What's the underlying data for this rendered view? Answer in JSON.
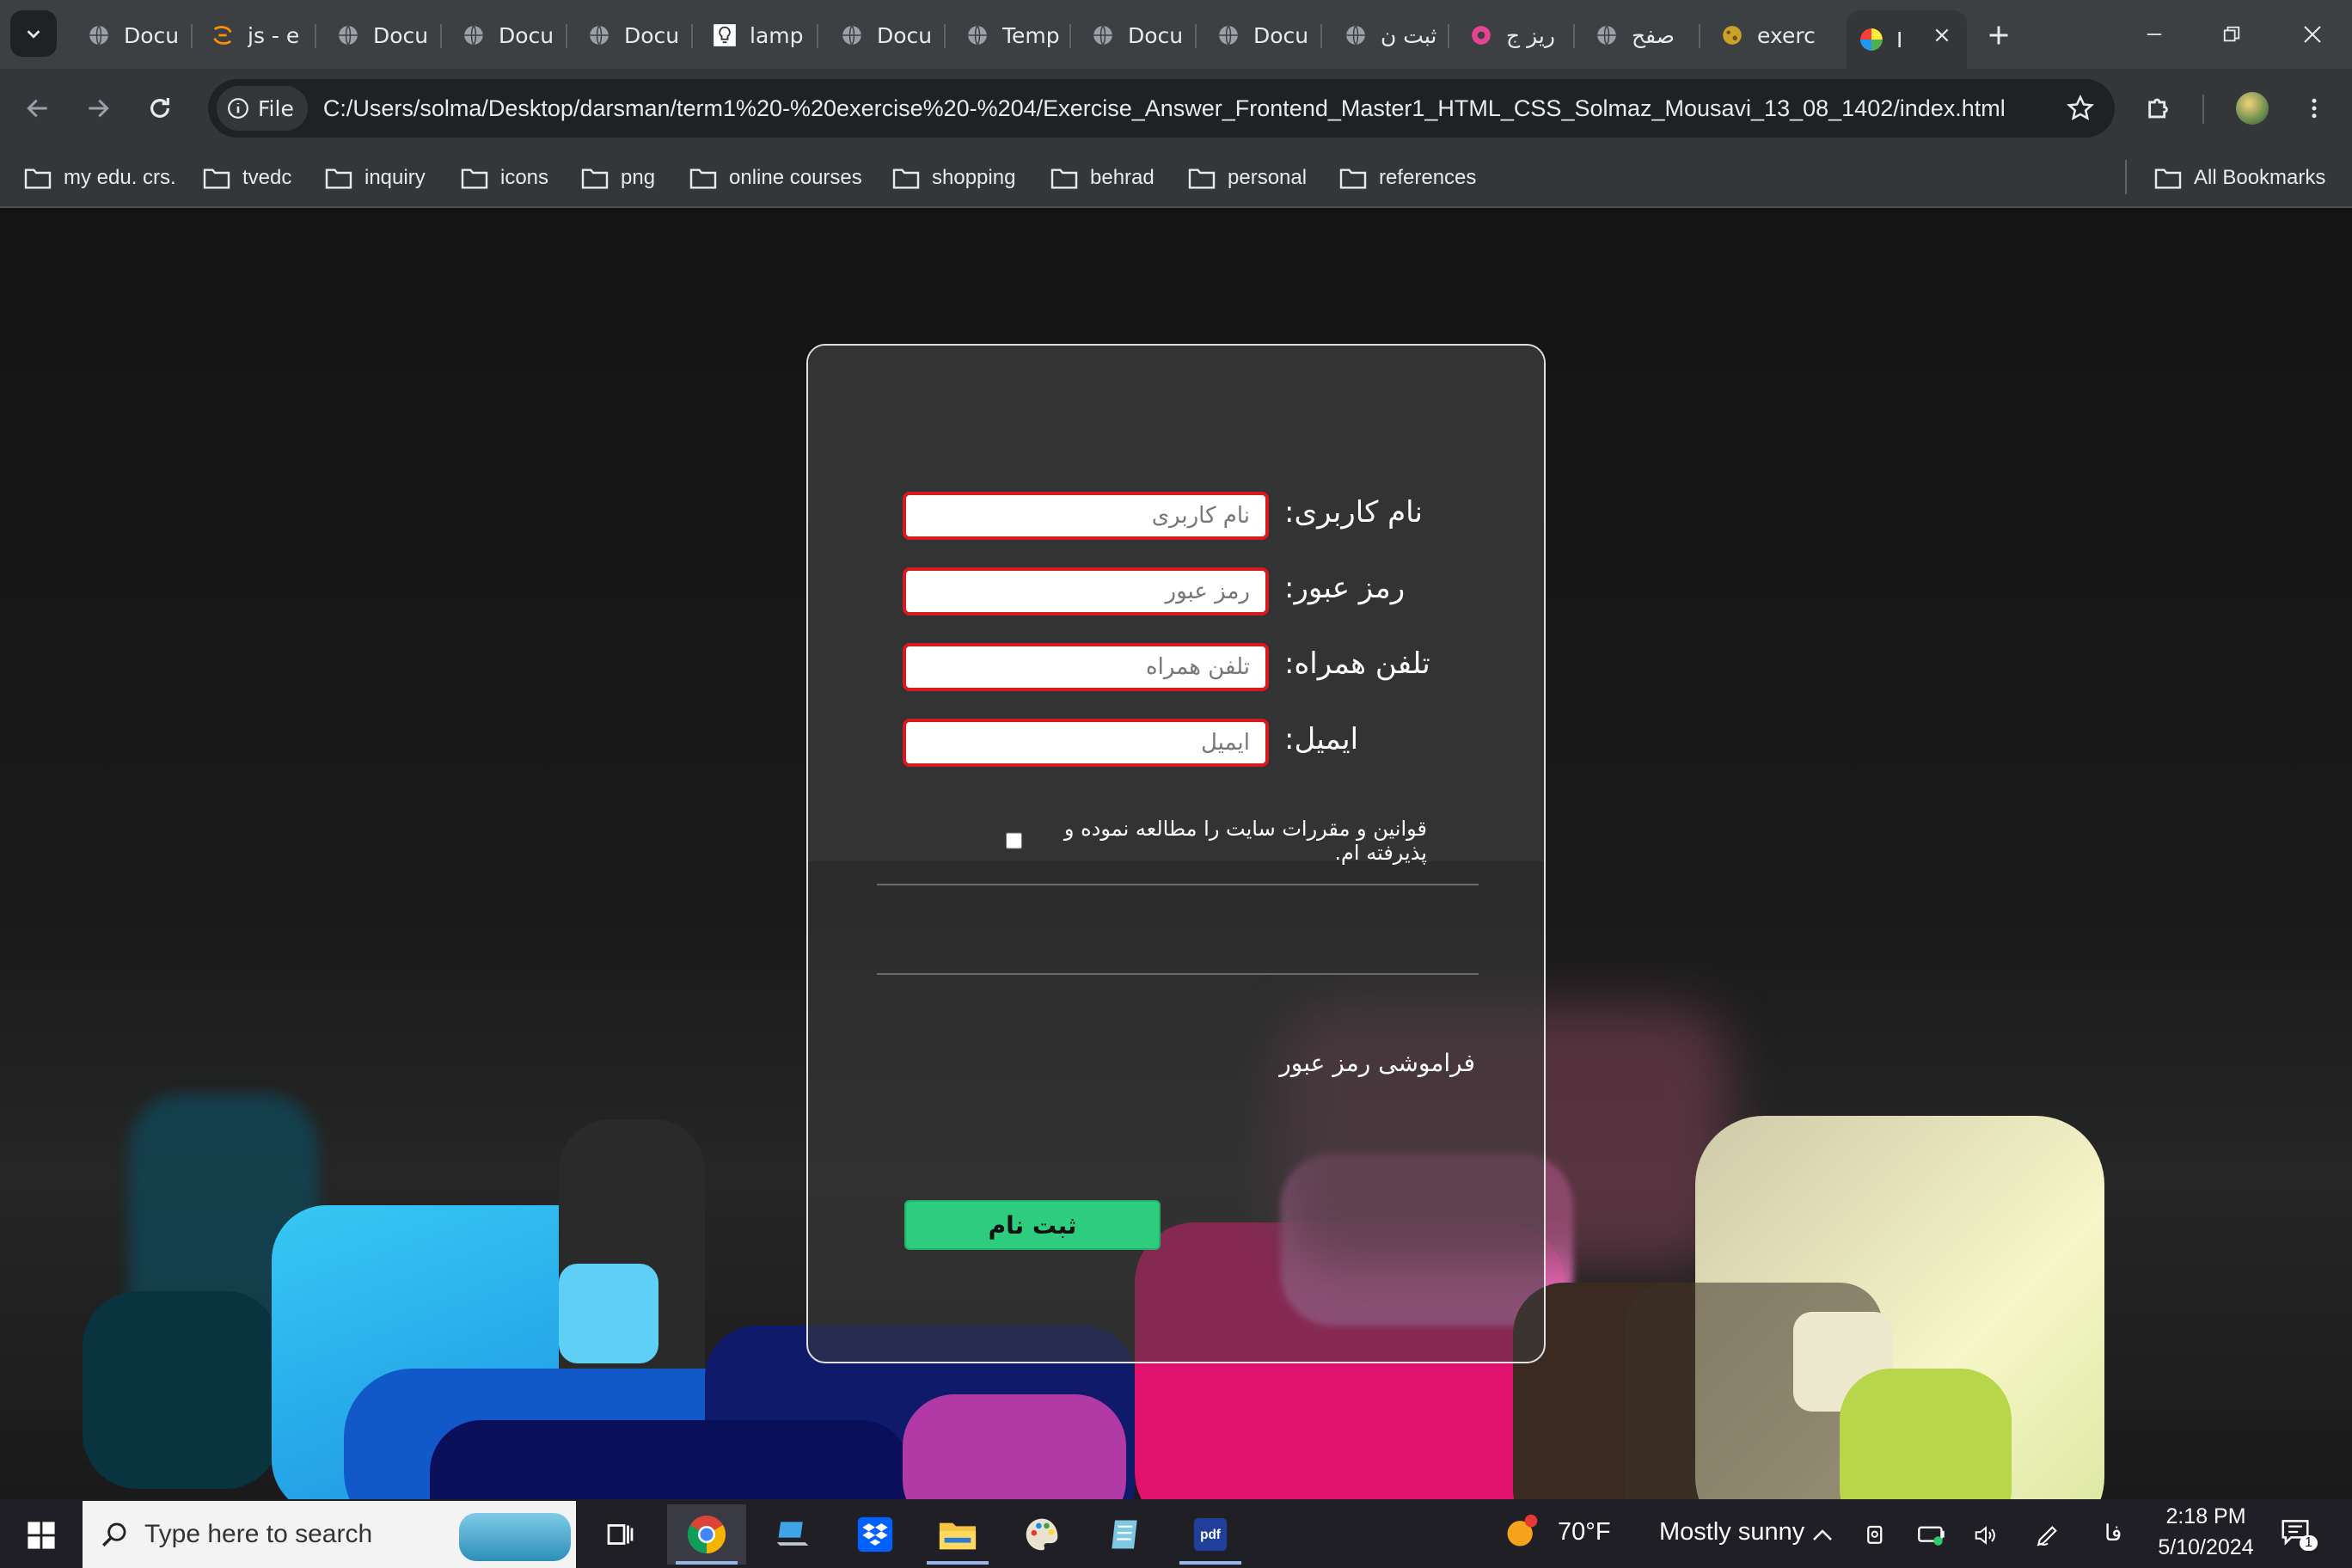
{
  "browser": {
    "tabs": [
      {
        "title": "Docu",
        "icon": "globe-icon"
      },
      {
        "title": "js - e",
        "icon": "sololearn-icon"
      },
      {
        "title": "Docu",
        "icon": "globe-icon"
      },
      {
        "title": "Docu",
        "icon": "globe-icon"
      },
      {
        "title": "Docu",
        "icon": "globe-icon"
      },
      {
        "title": "lamp",
        "icon": "lamp-icon"
      },
      {
        "title": "Docu",
        "icon": "globe-icon"
      },
      {
        "title": "Temp",
        "icon": "globe-icon"
      },
      {
        "title": "Docu",
        "icon": "globe-icon"
      },
      {
        "title": "Docu",
        "icon": "globe-icon"
      },
      {
        "title": "ثبت ن",
        "icon": "globe-icon"
      },
      {
        "title": "ریز ج",
        "icon": "donut-icon"
      },
      {
        "title": "صفح",
        "icon": "globe-icon"
      },
      {
        "title": "exerc",
        "icon": "codepen-icon"
      },
      {
        "title": "I",
        "icon": "color-wheel-icon",
        "active": true
      }
    ],
    "omnibox": {
      "scheme_label": "File",
      "url": "C:/Users/solma/Desktop/darsman/term1%20-%20exercise%20-%204/Exercise_Answer_Frontend_Master1_HTML_CSS_Solmaz_Mousavi_13_08_1402/index.html"
    },
    "bookmarks": [
      "my edu. crs.",
      "tvedc",
      "inquiry",
      "icons",
      "png",
      "online courses",
      "shopping",
      "behrad",
      "personal",
      "references"
    ],
    "all_bookmarks_label": "All Bookmarks"
  },
  "form": {
    "fields": [
      {
        "label": "نام کاربری:",
        "placeholder": "نام کاربری"
      },
      {
        "label": "رمز عبور:",
        "placeholder": "رمز عبور"
      },
      {
        "label": "تلفن همراه:",
        "placeholder": "تلفن همراه"
      },
      {
        "label": "ایمیل:",
        "placeholder": "ایمیل"
      }
    ],
    "terms_label": "قوانین و مقررات سایت را مطالعه نموده و پذیرفته ام.",
    "terms_checked": false,
    "forgot_password": "فراموشی رمز عبور",
    "submit_label": "ثبت نام"
  },
  "taskbar": {
    "search_placeholder": "Type here to search",
    "weather": {
      "temp": "70°F",
      "condition": "Mostly sunny"
    },
    "language": "فا",
    "time": "2:18 PM",
    "date": "5/10/2024",
    "notification_count": "1"
  },
  "colors": {
    "input_border": "#d71920",
    "submit_bg": "#2ecc7f",
    "card_border": "#e0e0e0"
  }
}
